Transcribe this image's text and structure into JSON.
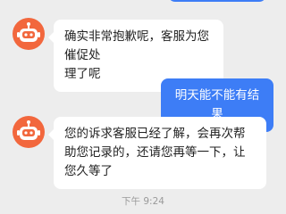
{
  "messages": [
    {
      "from": "agent",
      "text": "确实非常抱歉呢，客服为您催促处\n理了呢"
    },
    {
      "from": "user",
      "text": "明天能不能有结果"
    },
    {
      "from": "agent",
      "text": "您的诉求客服已经了解，会再次帮\n助您记录的，还请您再等一下，让\n您久等了"
    }
  ],
  "timestamp": "下午 9:24",
  "colors": {
    "background": "#ededed",
    "agent_bubble": "#ffffff",
    "user_bubble": "#3d7df6",
    "avatar": "#f2673d"
  },
  "icons": {
    "agent_avatar": "robot-avatar-icon"
  }
}
